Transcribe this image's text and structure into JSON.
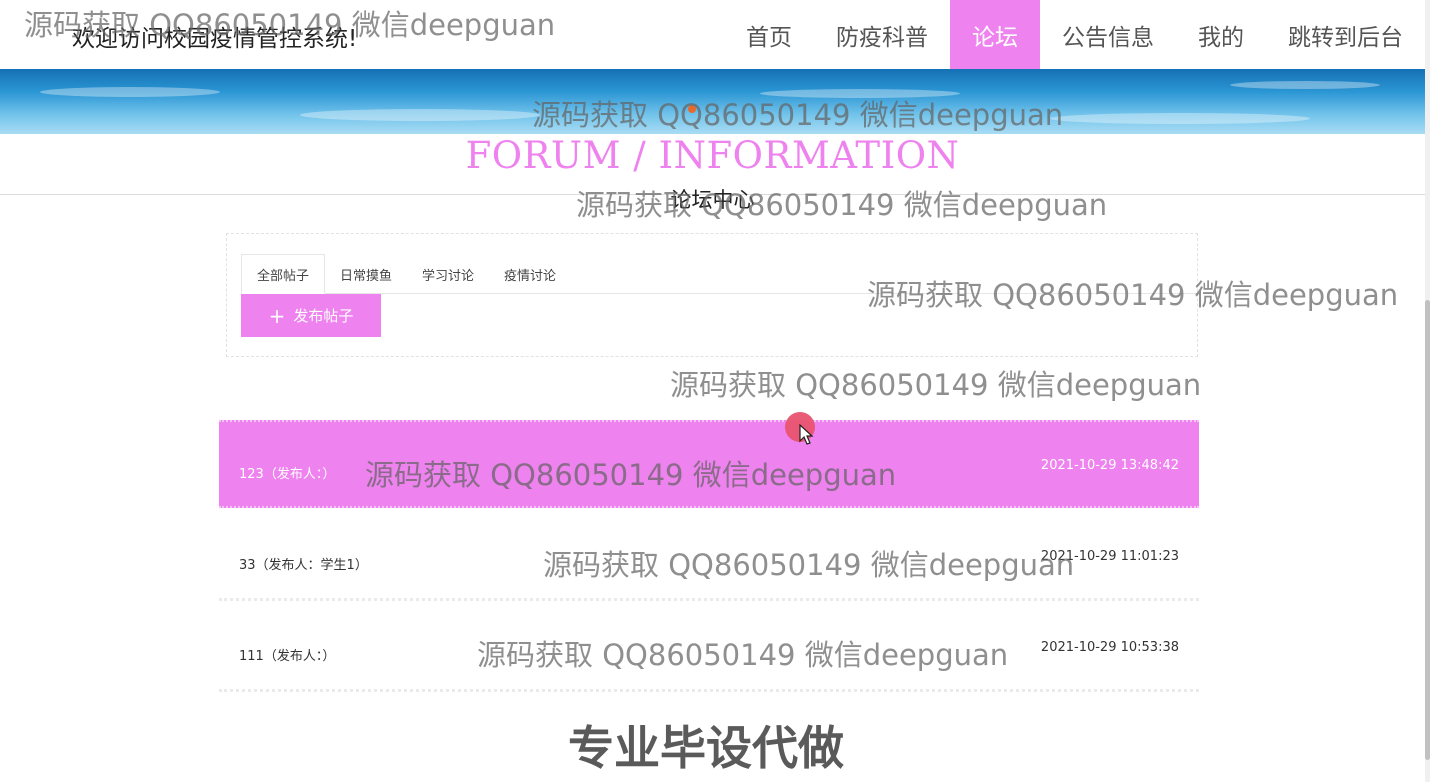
{
  "header": {
    "site_title": "欢迎访问校园疫情管控系统!",
    "nav": [
      {
        "label": "首页"
      },
      {
        "label": "防疫科普"
      },
      {
        "label": "论坛"
      },
      {
        "label": "公告信息"
      },
      {
        "label": "我的"
      },
      {
        "label": "跳转到后台"
      }
    ],
    "active_nav": "论坛"
  },
  "section": {
    "title_en": "FORUM / INFORMATION",
    "title_cn": "论坛中心"
  },
  "tabs": [
    {
      "label": "全部帖子"
    },
    {
      "label": "日常摸鱼"
    },
    {
      "label": "学习讨论"
    },
    {
      "label": "疫情讨论"
    }
  ],
  "active_tab": "全部帖子",
  "post_button": {
    "label": "发布帖子",
    "icon": "plus-icon"
  },
  "posts": [
    {
      "title": "123（发布人：）",
      "time": "2021-10-29 13:48:42"
    },
    {
      "title": "33（发布人：学生1）",
      "time": "2021-10-29 11:01:23"
    },
    {
      "title": "111（发布人：）",
      "time": "2021-10-29 10:53:38"
    }
  ],
  "watermark": {
    "text": "源码获取 QQ86050149 微信deepguan",
    "big_text": "专业毕设代做"
  },
  "colors": {
    "accent": "#ee82ee",
    "banner": "#2b96d4",
    "cursor": "#e8536f"
  }
}
